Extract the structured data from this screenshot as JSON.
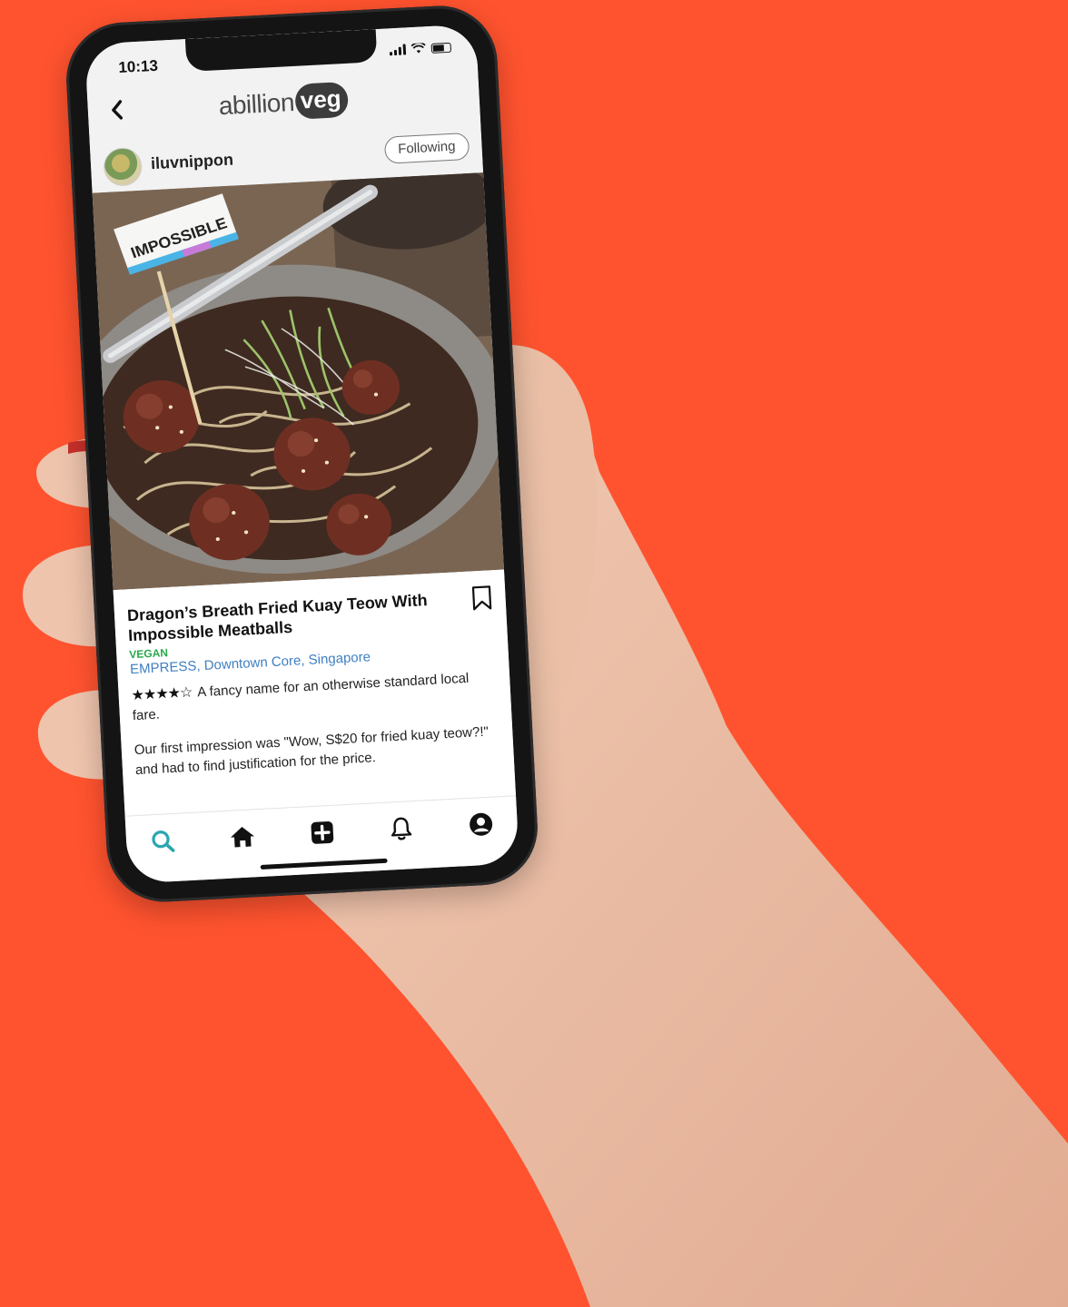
{
  "status_bar": {
    "time": "10:13"
  },
  "header": {
    "back_icon": "chevron-left-icon",
    "logo": {
      "text": "abillion",
      "badge": "veg"
    }
  },
  "user": {
    "username": "iluvnippon",
    "follow_label": "Following"
  },
  "post": {
    "title": "Dragon’s Breath Fried Kuay Teow With Impossible Meatballs",
    "badge": "VEGAN",
    "location": "EMPRESS, Downtown Core, Singapore",
    "rating": 4,
    "rating_max": 5,
    "stars_text": "★★★★☆",
    "review_line1": "A fancy name for an otherwise standard local fare.",
    "review_line2": "Our first impression was \"Wow, S$20 for fried kuay teow?!\" and had to find justification for the price.",
    "photo_flag": "IMPOSSIBLE"
  },
  "nav": {
    "items": [
      {
        "name": "search",
        "icon": "search-icon",
        "active": true
      },
      {
        "name": "home",
        "icon": "home-icon",
        "active": false
      },
      {
        "name": "add",
        "icon": "plus-square-icon",
        "active": false
      },
      {
        "name": "notifications",
        "icon": "bell-icon",
        "active": false
      },
      {
        "name": "profile",
        "icon": "user-circle-icon",
        "active": false
      }
    ]
  },
  "colors": {
    "background": "#FF532F",
    "vegan_green": "#2aa84a",
    "location_blue": "#3f7fc1",
    "nav_active": "#2aa6b0"
  }
}
